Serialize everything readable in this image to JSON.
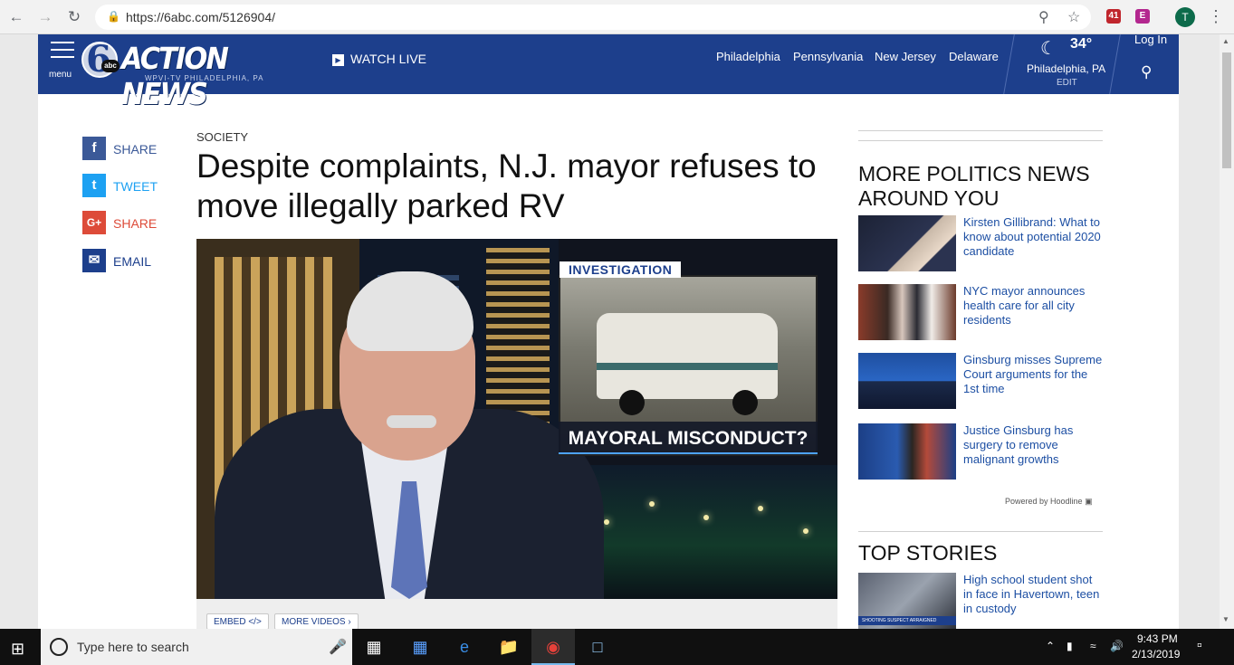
{
  "browser": {
    "url": "https://6abc.com/5126904/",
    "ext_badge": "41",
    "profile_initial": "T"
  },
  "header": {
    "menu_label": "menu",
    "logo_text": "ACTION NEWS",
    "logo_number": "6",
    "logo_abc": "abc",
    "logo_sub": "WPVI-TV  PHILADELPHIA, PA",
    "watch_live": "WATCH LIVE",
    "regions": [
      "Philadelphia",
      "Pennsylvania",
      "New Jersey",
      "Delaware"
    ],
    "weather": {
      "temp": "34°",
      "city": "Philadelphia, PA",
      "edit": "EDIT"
    },
    "login": "Log In"
  },
  "share": [
    {
      "label": "SHARE",
      "icon": "f",
      "color": "#3b5998"
    },
    {
      "label": "TWEET",
      "icon": "t",
      "color": "#1da1f2"
    },
    {
      "label": "SHARE",
      "icon": "G+",
      "color": "#dd4b39"
    },
    {
      "label": "EMAIL",
      "icon": "✉",
      "color": "#1d3f8c"
    }
  ],
  "article": {
    "category": "SOCIETY",
    "headline": "Despite complaints, N.J. mayor refuses to move illegally parked RV",
    "video_tag": "INVESTIGATION",
    "video_banner": "MAYORAL MISCONDUCT?",
    "embed_label": "EMBED </>",
    "more_videos_label": "MORE VIDEOS ›"
  },
  "sidebar": {
    "politics_heading": "MORE POLITICS NEWS AROUND YOU",
    "politics_items": [
      "Kirsten Gillibrand: What to know about potential 2020 candidate",
      "NYC mayor announces health care for all city residents",
      "Ginsburg misses Supreme Court arguments for the 1st time",
      "Justice Ginsburg has surgery to remove malignant growths"
    ],
    "powered_by": "Powered by Hoodline",
    "top_heading": "TOP STORIES",
    "top_items": [
      "High school student shot in face in Havertown, teen in custody"
    ],
    "top_thumb_caption": "SHOOTING SUSPECT ARRAIGNED"
  },
  "taskbar": {
    "search_placeholder": "Type here to search",
    "time": "9:43 PM",
    "date": "2/13/2019"
  }
}
